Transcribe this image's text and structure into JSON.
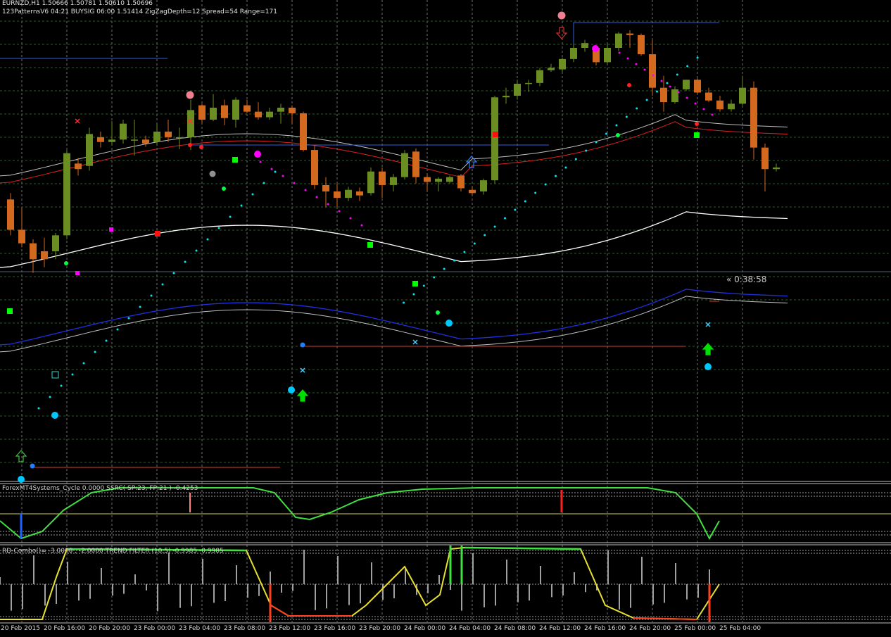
{
  "header": {
    "symbol_line": "EURNZD,H1  1.50666 1.50781 1.50610 1.50696",
    "pattern_line": "123PatternsV6  04:21  BUYSIG  06:00  1.51414  ZigZagDepth=12  Spread=54  Range=171"
  },
  "timer": "« 0:38:58",
  "subwindows": {
    "cycle_label": "ForexMT4Systems_Cycle 0.0000  SSRC( SP:23, FP:21 ) -0.4253",
    "combo_label": "RD-Combo()= -3.0000 , -2.0000  TREND FILTER (10,5) -0.9985 -0.9985"
  },
  "colors": {
    "background": "#000000",
    "bull": "#6b8e23",
    "bear": "#d2691e",
    "envelope": "#c0c0c0",
    "red_band": "#e02020",
    "blue_band": "#2030e0",
    "midline": "#ffffff",
    "signal_green": "#00ff00",
    "cyan_dots": "#00e5ee",
    "magenta_dots": "#ff00ff"
  },
  "chart_data": {
    "type": "candlestick",
    "symbol": "EURNZD",
    "timeframe": "H1",
    "ylim": [
      1.47,
      1.53
    ],
    "x_tick_labels": [
      "20 Feb 2015",
      "20 Feb 16:00",
      "20 Feb 20:00",
      "23 Feb 00:00",
      "23 Feb 04:00",
      "23 Feb 08:00",
      "23 Feb 12:00",
      "23 Feb 16:00",
      "23 Feb 20:00",
      "24 Feb 00:00",
      "24 Feb 04:00",
      "24 Feb 08:00",
      "24 Feb 12:00",
      "24 Feb 16:00",
      "24 Feb 20:00",
      "25 Feb 00:00",
      "25 Feb 04:00"
    ],
    "ohlc": [
      [
        1.505,
        1.5058,
        1.5005,
        1.5012
      ],
      [
        1.5012,
        1.504,
        1.499,
        1.4995
      ],
      [
        1.4995,
        1.5,
        1.4958,
        1.4975
      ],
      [
        1.4985,
        1.5002,
        1.4965,
        1.4975
      ],
      [
        1.4985,
        1.5008,
        1.4975,
        1.5005
      ],
      [
        1.5005,
        1.5112,
        1.5,
        1.5108
      ],
      [
        1.5095,
        1.5102,
        1.508,
        1.5088
      ],
      [
        1.5092,
        1.514,
        1.5086,
        1.5132
      ],
      [
        1.5128,
        1.5135,
        1.5115,
        1.5122
      ],
      [
        1.5122,
        1.5148,
        1.5118,
        1.5125
      ],
      [
        1.5125,
        1.515,
        1.512,
        1.5145
      ],
      [
        1.5125,
        1.515,
        1.5105,
        1.5125
      ],
      [
        1.5125,
        1.513,
        1.5116,
        1.512
      ],
      [
        1.5122,
        1.5145,
        1.5118,
        1.5135
      ],
      [
        1.5135,
        1.515,
        1.5122,
        1.5128
      ],
      [
        1.5128,
        1.514,
        1.5113,
        1.5128
      ],
      [
        1.5128,
        1.5175,
        1.5112,
        1.5162
      ],
      [
        1.5168,
        1.517,
        1.5145,
        1.515
      ],
      [
        1.515,
        1.5182,
        1.5148,
        1.5165
      ],
      [
        1.5168,
        1.5175,
        1.5143,
        1.5152
      ],
      [
        1.515,
        1.5178,
        1.514,
        1.5175
      ],
      [
        1.5168,
        1.5175,
        1.5158,
        1.516
      ],
      [
        1.516,
        1.5172,
        1.515,
        1.5153
      ],
      [
        1.5153,
        1.5165,
        1.515,
        1.516
      ],
      [
        1.516,
        1.517,
        1.5145,
        1.5165
      ],
      [
        1.5165,
        1.5168,
        1.5145,
        1.5158
      ],
      [
        1.5158,
        1.516,
        1.511,
        1.5112
      ],
      [
        1.5112,
        1.5118,
        1.5063,
        1.5068
      ],
      [
        1.5068,
        1.5078,
        1.504,
        1.506
      ],
      [
        1.506,
        1.507,
        1.504,
        1.5052
      ],
      [
        1.5052,
        1.5066,
        1.5048,
        1.5062
      ],
      [
        1.506,
        1.5065,
        1.5048,
        1.5055
      ],
      [
        1.5058,
        1.509,
        1.5055,
        1.5085
      ],
      [
        1.5085,
        1.509,
        1.5052,
        1.5068
      ],
      [
        1.5068,
        1.5082,
        1.506,
        1.5078
      ],
      [
        1.5078,
        1.5112,
        1.5075,
        1.5108
      ],
      [
        1.511,
        1.5114,
        1.507,
        1.5078
      ],
      [
        1.5078,
        1.5082,
        1.506,
        1.5072
      ],
      [
        1.5072,
        1.5078,
        1.506,
        1.5076
      ],
      [
        1.5072,
        1.508,
        1.507,
        1.5078
      ],
      [
        1.508,
        1.5082,
        1.506,
        1.5064
      ],
      [
        1.5062,
        1.5066,
        1.5055,
        1.5058
      ],
      [
        1.506,
        1.5076,
        1.5056,
        1.5074
      ],
      [
        1.5074,
        1.518,
        1.507,
        1.5178
      ],
      [
        1.5178,
        1.519,
        1.517,
        1.518
      ],
      [
        1.518,
        1.52,
        1.5175,
        1.5195
      ],
      [
        1.5195,
        1.52,
        1.5185,
        1.5196
      ],
      [
        1.5196,
        1.5215,
        1.5192,
        1.5212
      ],
      [
        1.5212,
        1.522,
        1.521,
        1.5215
      ],
      [
        1.5213,
        1.5228,
        1.521,
        1.5226
      ],
      [
        1.5226,
        1.5245,
        1.5222,
        1.524
      ],
      [
        1.524,
        1.525,
        1.5235,
        1.5246
      ],
      [
        1.524,
        1.5242,
        1.5218,
        1.5222
      ],
      [
        1.5222,
        1.5245,
        1.522,
        1.524
      ],
      [
        1.524,
        1.526,
        1.5236,
        1.5258
      ],
      [
        1.5258,
        1.5262,
        1.524,
        1.5256
      ],
      [
        1.5256,
        1.5258,
        1.523,
        1.5232
      ],
      [
        1.5232,
        1.525,
        1.518,
        1.519
      ],
      [
        1.519,
        1.5205,
        1.516,
        1.5172
      ],
      [
        1.5172,
        1.5192,
        1.517,
        1.5188
      ],
      [
        1.5188,
        1.52,
        1.5186,
        1.52
      ],
      [
        1.52,
        1.5202,
        1.5182,
        1.5184
      ],
      [
        1.5184,
        1.519,
        1.5172,
        1.5174
      ],
      [
        1.5174,
        1.518,
        1.516,
        1.5163
      ],
      [
        1.5163,
        1.5175,
        1.516,
        1.517
      ],
      [
        1.517,
        1.5205,
        1.5168,
        1.519
      ],
      [
        1.519,
        1.5198,
        1.51,
        1.5115
      ],
      [
        1.5115,
        1.512,
        1.506,
        1.5088
      ],
      [
        1.5088,
        1.5095,
        1.5085,
        1.509
      ]
    ]
  }
}
